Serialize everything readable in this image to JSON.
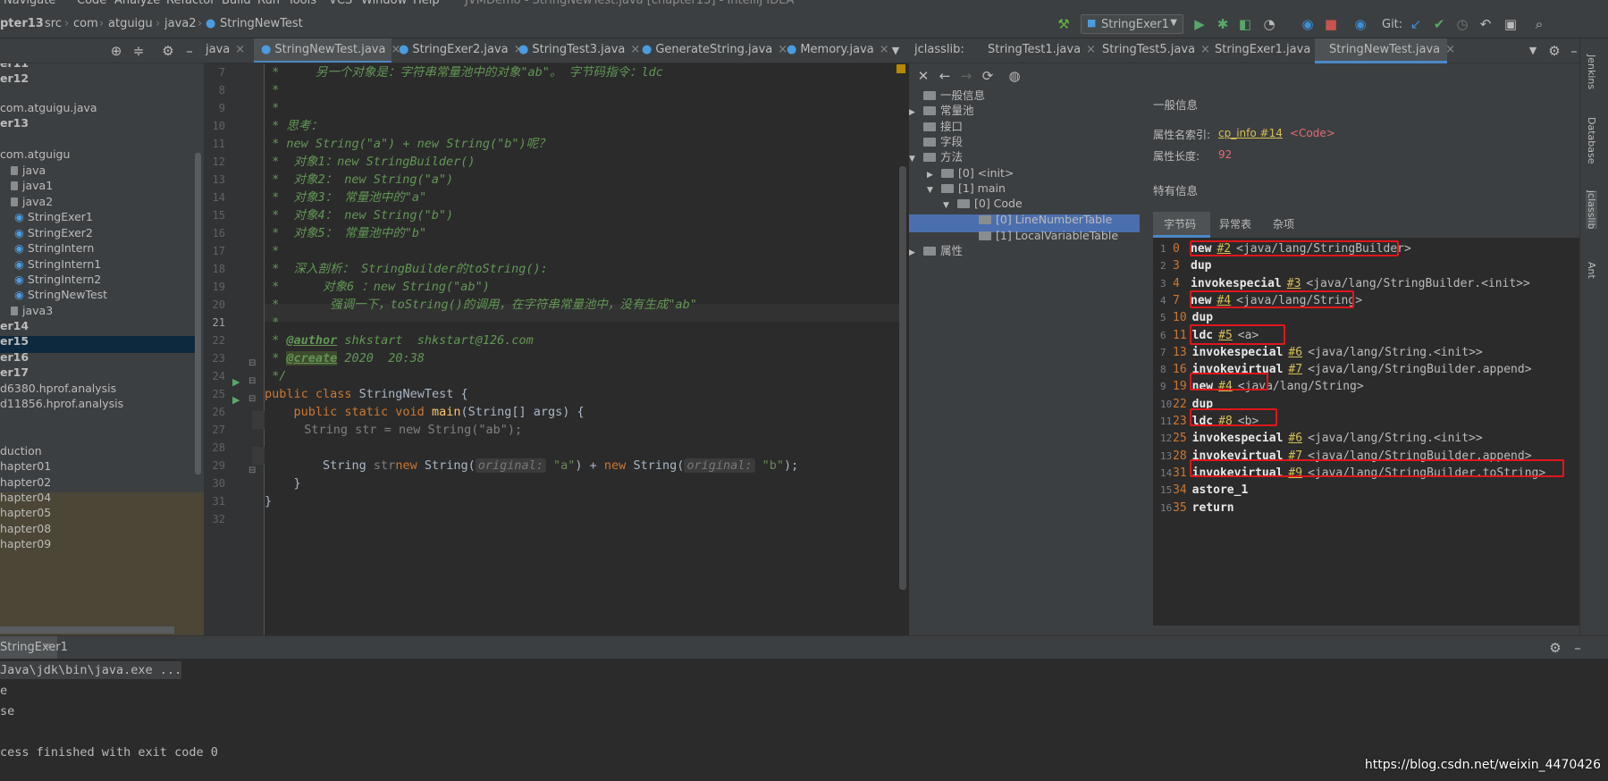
{
  "menu": [
    "Navigate",
    "Code",
    "Analyze",
    "Refactor",
    "Build",
    "Run",
    "Tools",
    "VCS",
    "Window",
    "Help",
    "JVMDemo - StringNewTest.java [chapter13] - IntelliJ IDEA"
  ],
  "breadcrumb": [
    "pter13",
    "src",
    "com",
    "atguigu",
    "java2",
    "StringNewTest"
  ],
  "run_config": "StringExer1",
  "git_label": "Git:",
  "project_tree": [
    {
      "t": "er11",
      "b": true
    },
    {
      "t": "er12",
      "b": true
    },
    {
      "t": "com.atguigu.java",
      "b": false
    },
    {
      "t": "er13",
      "b": true
    },
    {
      "t": "com.atguigu",
      "b": false
    },
    {
      "t": "java",
      "b": false
    },
    {
      "t": "java1",
      "b": false
    },
    {
      "t": "java2",
      "b": false
    },
    {
      "t": "StringExer1",
      "b": false
    },
    {
      "t": "StringExer2",
      "b": false
    },
    {
      "t": "StringIntern",
      "b": false
    },
    {
      "t": "StringIntern1",
      "b": false
    },
    {
      "t": "StringIntern2",
      "b": false
    },
    {
      "t": "StringNewTest",
      "b": false
    },
    {
      "t": "java3",
      "b": false
    },
    {
      "t": "er14",
      "b": true
    },
    {
      "t": "er15",
      "b": true
    },
    {
      "t": "er16",
      "b": true
    },
    {
      "t": "er17",
      "b": true
    },
    {
      "t": "d6380.hprof.analysis",
      "b": false
    },
    {
      "t": "d11856.hprof.analysis",
      "b": false
    },
    {
      "t": "duction",
      "b": false
    },
    {
      "t": "hapter01",
      "b": false
    },
    {
      "t": "hapter02",
      "b": false
    },
    {
      "t": "hapter04",
      "b": false
    },
    {
      "t": "hapter05",
      "b": false
    },
    {
      "t": "hapter08",
      "b": false
    },
    {
      "t": "hapter09",
      "b": false
    }
  ],
  "editor_tabs": [
    "java",
    "StringNewTest.java",
    "StringExer2.java",
    "StringTest3.java",
    "GenerateString.java",
    "Memory.java"
  ],
  "line_numbers": [
    "7",
    "8",
    "9",
    "10",
    "11",
    "12",
    "13",
    "14",
    "15",
    "16",
    "17",
    "18",
    "19",
    "20",
    "21",
    "22",
    "23",
    "24",
    "25",
    "26",
    "27",
    "28",
    "29",
    "30",
    "31",
    "32"
  ],
  "code": {
    "l7": " *     另一个对象是：字符串常量池中的对象\"ab\"。 字节码指令：ldc",
    "l8": " *",
    "l9": " *",
    "l10": " * 思考：",
    "l11": " * new String(\"a\") + new String(\"b\")呢？",
    "l12": " *  对象1：new StringBuilder()",
    "l13": " *  对象2： new String(\"a\")",
    "l14": " *  对象3： 常量池中的\"a\"",
    "l15": " *  对象4： new String(\"b\")",
    "l16": " *  对象5： 常量池中的\"b\"",
    "l17": " *",
    "l18": " *  深入剖析： StringBuilder的toString():",
    "l19": " *      对象6 ：new String(\"ab\")",
    "l20": " *       强调一下，toString()的调用，在字符串常量池中，没有生成\"ab\"",
    "l21": " *",
    "l22_a": " * ",
    "l22_tag": "@author",
    "l22_b": " shkstart  shkstart@126.com",
    "l23_a": " * ",
    "l23_tag": "@create",
    "l23_b": " 2020  20:38",
    "l24": " */",
    "l25_kw": "public class ",
    "l25_b": "StringNewTest {",
    "l26_kw": "    public static void ",
    "l26_fn": "main",
    "l26_b": "(String[] args) {",
    "l27_cm": "//",
    "l27_b": "        String str = new String(\"ab\");",
    "l29_a": "        String ",
    "l29_var": "str",
    " l29_eq": " = ",
    "l29_new1": "new ",
    "l29_cls1": "String(",
    "l29_hint1": "original:",
    "l29_s1": " \"a\"",
    "l29_plus": ") + ",
    "l29_new2": "new ",
    "l29_cls2": "String(",
    "l29_hint2": "original:",
    "l29_s2": " \"b\"",
    "l29_end": ");",
    "l30": "    }",
    "l31": "}"
  },
  "jclasslib_tabs": [
    "jclasslib:",
    "StringTest1.java",
    "StringTest5.java",
    "StringExer1.java",
    "StringNewTest.java"
  ],
  "jtree": [
    {
      "t": "一般信息"
    },
    {
      "t": "常量池"
    },
    {
      "t": "接口"
    },
    {
      "t": "字段"
    },
    {
      "t": "方法"
    },
    {
      "t": "[0] <init>"
    },
    {
      "t": "[1] main"
    },
    {
      "t": "[0] Code"
    },
    {
      "t": "[0] LineNumberTable"
    },
    {
      "t": "[1] LocalVariableTable"
    },
    {
      "t": "属性"
    }
  ],
  "general_info": {
    "title": "一般信息",
    "name_index_label": "属性名索引:",
    "name_index_link": "cp_info #14",
    "name_index_value": "<Code>",
    "length_label": "属性长度:",
    "length_value": "92",
    "specific_title": "特有信息"
  },
  "subtabs": [
    "字节码",
    "异常表",
    "杂项"
  ],
  "bytecode": [
    {
      "n": "1",
      "o": "0",
      "i": "new",
      "r": "#2",
      "a": "<java/lang/StringBuilder>"
    },
    {
      "n": "2",
      "o": "3",
      "i": "dup",
      "r": "",
      "a": ""
    },
    {
      "n": "3",
      "o": "4",
      "i": "invokespecial",
      "r": "#3",
      "a": "<java/lang/StringBuilder.<init>>"
    },
    {
      "n": "4",
      "o": "7",
      "i": "new",
      "r": "#4",
      "a": "<java/lang/String>"
    },
    {
      "n": "5",
      "o": "10",
      "i": "dup",
      "r": "",
      "a": ""
    },
    {
      "n": "6",
      "o": "11",
      "i": "ldc",
      "r": "#5",
      "a": "<a>"
    },
    {
      "n": "7",
      "o": "13",
      "i": "invokespecial",
      "r": "#6",
      "a": "<java/lang/String.<init>>"
    },
    {
      "n": "8",
      "o": "16",
      "i": "invokevirtual",
      "r": "#7",
      "a": "<java/lang/StringBuilder.append>"
    },
    {
      "n": "9",
      "o": "19",
      "i": "new",
      "r": "#4",
      "a": "<java/lang/String>"
    },
    {
      "n": "10",
      "o": "22",
      "i": "dup",
      "r": "",
      "a": ""
    },
    {
      "n": "11",
      "o": "23",
      "i": "ldc",
      "r": "#8",
      "a": "<b>"
    },
    {
      "n": "12",
      "o": "25",
      "i": "invokespecial",
      "r": "#6",
      "a": "<java/lang/String.<init>>"
    },
    {
      "n": "13",
      "o": "28",
      "i": "invokevirtual",
      "r": "#7",
      "a": "<java/lang/StringBuilder.append>"
    },
    {
      "n": "14",
      "o": "31",
      "i": "invokevirtual",
      "r": "#9",
      "a": "<java/lang/StringBuilder.toString>"
    },
    {
      "n": "15",
      "o": "34",
      "i": "astore_1",
      "r": "",
      "a": ""
    },
    {
      "n": "16",
      "o": "35",
      "i": "return",
      "r": "",
      "a": ""
    }
  ],
  "right_strip": [
    "Jenkins",
    "Database",
    "jclasslib",
    "Ant"
  ],
  "run_tab": "StringExer1",
  "run_output": [
    "Java\\jdk\\bin\\java.exe ...",
    "e",
    "se",
    "",
    "cess finished with exit code 0"
  ],
  "watermark": "https://blog.csdn.net/weixin_4470426"
}
